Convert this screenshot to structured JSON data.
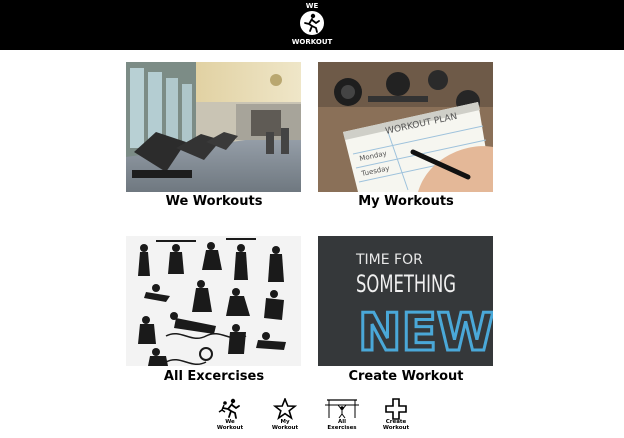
{
  "header": {
    "logo_top": "WE",
    "logo_bottom": "WORKOUT"
  },
  "tiles": [
    {
      "label": "We Workouts",
      "image": "gym-photo"
    },
    {
      "label": "My Workouts",
      "image": "workout-plan-photo"
    },
    {
      "label": "All Excercises",
      "image": "exercise-silhouettes"
    },
    {
      "label": "Create Workout",
      "image": "chalkboard"
    }
  ],
  "chalkboard": {
    "line1": "TIME FOR",
    "line2": "SOMETHING",
    "line3": "NEW!"
  },
  "notepad": {
    "title": "WORKOUT PLAN",
    "row1": "Monday",
    "row2": "Tuesday"
  },
  "bottom_nav": [
    {
      "label": "We\nWorkout",
      "icon": "runner-icon"
    },
    {
      "label": "My\nWorkout",
      "icon": "star-icon"
    },
    {
      "label": "All\nExercises",
      "icon": "pullup-bar-icon"
    },
    {
      "label": "Create\nWorkout",
      "icon": "plus-icon"
    }
  ],
  "colors": {
    "header_bg": "#000000",
    "chalk_blue": "#4aa8d8"
  }
}
